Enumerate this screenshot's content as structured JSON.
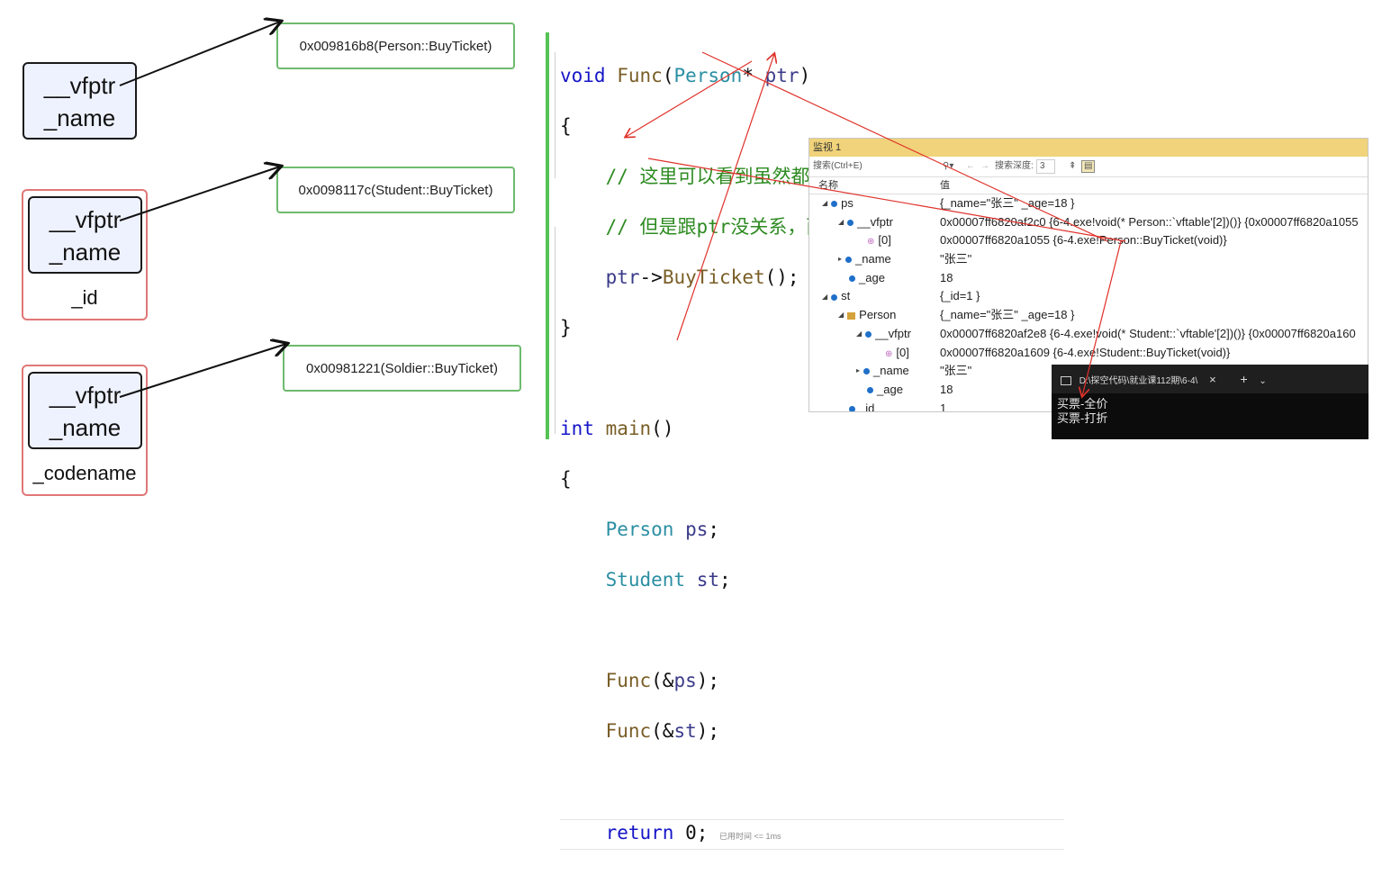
{
  "objects": [
    {
      "field1": "__vfptr",
      "field2": "_name",
      "extra": "",
      "vtable": "0x009816b8(Person::BuyTicket)"
    },
    {
      "field1": "__vfptr",
      "field2": "_name",
      "extra": "_id",
      "vtable": "0x0098117c(Student::BuyTicket)"
    },
    {
      "field1": "__vfptr",
      "field2": "_name",
      "extra": "_codename",
      "vtable": "0x00981221(Soldier::BuyTicket)"
    }
  ],
  "code": {
    "func_kw": "void",
    "func_name": "Func",
    "func_open": "(",
    "func_type": "Person",
    "func_star": "*",
    "func_param": "ptr",
    "func_close": ")",
    "brace_open1": "{",
    "comment1": "// 这里可以看到虽然都是Person指针Ptr在调用BuyTicket",
    "comment2": "// 但是跟ptr没关系，而是由ptr指向的对象决定的。",
    "call_ptr": "ptr",
    "call_arrow": "->",
    "call_fn": "BuyTicket",
    "call_end": "();",
    "brace_close1": "}",
    "main_kw": "int",
    "main_name": "main",
    "main_parens": "()",
    "brace_open2": "{",
    "decl1_type": "Person",
    "decl1_var": "ps",
    "decl1_end": ";",
    "decl2_type": "Student",
    "decl2_var": "st",
    "decl2_end": ";",
    "call1_fn": "Func",
    "call1_arg": "(&",
    "call1_var": "ps",
    "call1_end": ");",
    "call2_fn": "Func",
    "call2_arg": "(&",
    "call2_var": "st",
    "call2_end": ");",
    "ret_kw": "return",
    "ret_val": "0;",
    "elapsed": "已用时间 <= 1ms"
  },
  "watch": {
    "title": "监视 1",
    "search_placeholder": "搜索(Ctrl+E)",
    "depth_label": "搜索深度:",
    "depth_value": "3",
    "col_name": "名称",
    "col_value": "值",
    "rows": [
      {
        "name": "ps",
        "value": "{_name=\"张三\" _age=18 }"
      },
      {
        "name": "__vfptr",
        "value": "0x00007ff6820af2c0 {6-4.exe!void(* Person::`vftable'[2])()} {0x00007ff6820a1055"
      },
      {
        "name": "[0]",
        "value": "0x00007ff6820a1055 {6-4.exe!Person::BuyTicket(void)}"
      },
      {
        "name": "_name",
        "value": "\"张三\""
      },
      {
        "name": "_age",
        "value": "18"
      },
      {
        "name": "st",
        "value": "{_id=1 }"
      },
      {
        "name": "Person",
        "value": "{_name=\"张三\" _age=18 }"
      },
      {
        "name": "__vfptr",
        "value": "0x00007ff6820af2e8 {6-4.exe!void(* Student::`vftable'[2])()} {0x00007ff6820a160"
      },
      {
        "name": "[0]",
        "value": "0x00007ff6820a1609 {6-4.exe!Student::BuyTicket(void)}"
      },
      {
        "name": "_name",
        "value": "\"张三\""
      },
      {
        "name": "_age",
        "value": "18"
      },
      {
        "name": "_id",
        "value": "1"
      }
    ]
  },
  "terminal": {
    "tab_title": "D:\\探空代码\\就业课112期\\6-4\\",
    "close": "×",
    "plus": "+",
    "chevron": "⌄",
    "lines": [
      "买票-全价",
      "买票-打折"
    ]
  },
  "colors": {
    "arrow_black": "#111111",
    "arrow_red": "#e0312a",
    "box_green": "#6dbb6d",
    "box_red": "#e07777",
    "editor_bar": "#55c455"
  }
}
